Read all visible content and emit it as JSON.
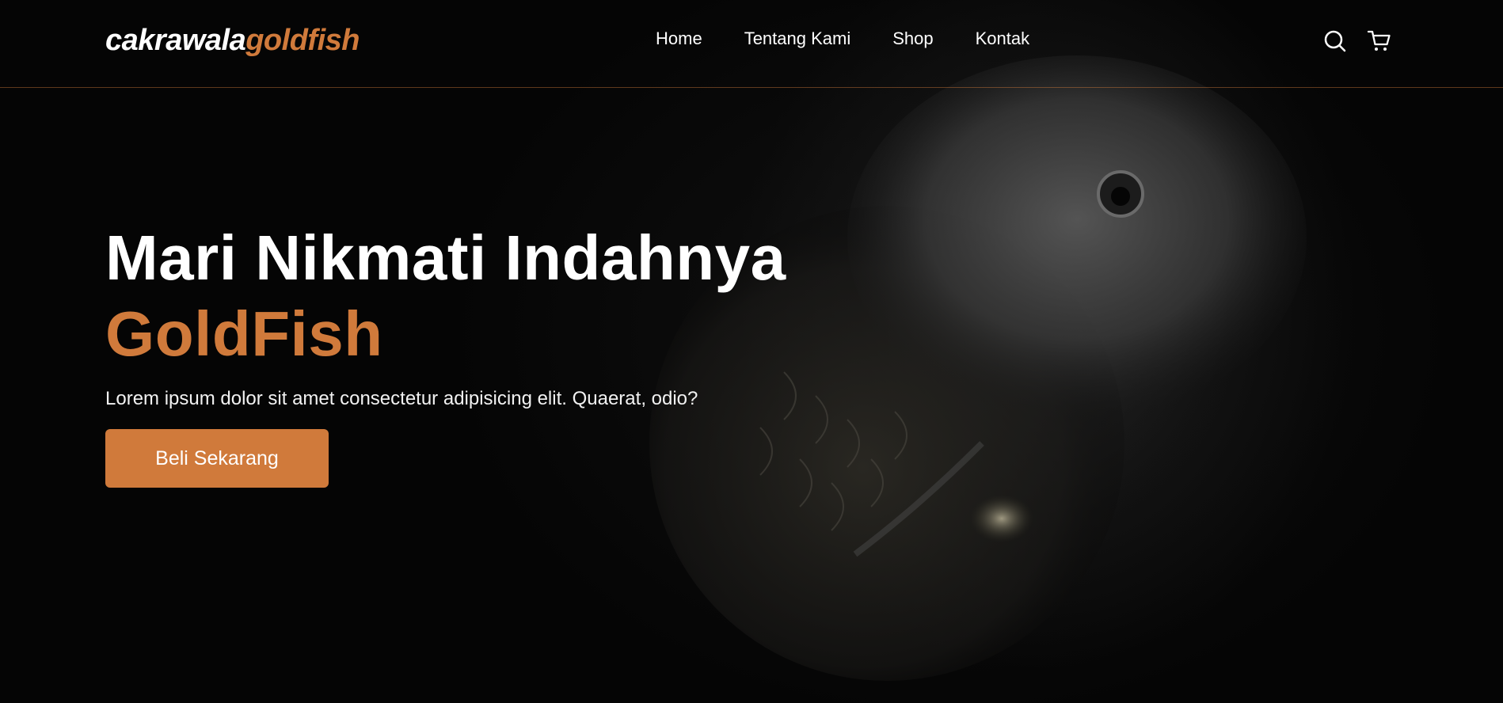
{
  "brand": {
    "name_part1": "cakrawala",
    "name_part2": "goldfish",
    "accent_color": "#d07a3b"
  },
  "nav": {
    "links": [
      {
        "label": "Home"
      },
      {
        "label": "Tentang Kami"
      },
      {
        "label": "Shop"
      },
      {
        "label": "Kontak"
      }
    ],
    "icons": [
      "search-icon",
      "shopping-cart-icon"
    ]
  },
  "hero": {
    "title_line1": "Mari Nikmati Indahnya",
    "title_line2": "GoldFish",
    "subtitle": "Lorem ipsum dolor sit amet consectetur adipisicing elit. Quaerat, odio?",
    "cta_label": "Beli Sekarang",
    "background": "dark goldfish photo"
  }
}
